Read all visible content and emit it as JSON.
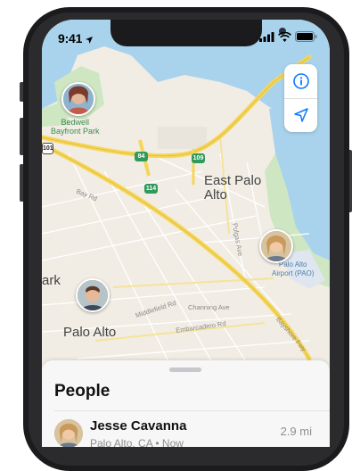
{
  "status_bar": {
    "time": "9:41"
  },
  "map": {
    "labels": {
      "bedwell": "Bedwell\nBayfront Park",
      "east_palo_alto": "East Palo\nAlto",
      "palo_alto": "Palo Alto",
      "park": "ark",
      "airport": "Palo Alto\nAirport (PAO)",
      "bay_rd": "Bay Rd",
      "pulgas": "Pulgas Ave",
      "middlefield": "Middlefield Rd",
      "channing": "Channing Ave",
      "embarcadero": "Embarcadero Rd",
      "bayshore": "Bayshore Fwy"
    },
    "shields": {
      "s101": "101",
      "s84": "84",
      "s109": "109",
      "s114": "114"
    }
  },
  "controls": {
    "info_icon": "info-icon",
    "location_icon": "location-arrow-icon"
  },
  "sheet": {
    "title": "People",
    "people": [
      {
        "name": "Jesse Cavanna",
        "subtitle": "Palo Alto, CA • Now",
        "distance": "2.9 mi"
      }
    ]
  },
  "colors": {
    "water": "#a9d3ec",
    "land": "#f1ede4",
    "park": "#cfe6c3",
    "highway": "#f5d65a",
    "accent": "#0a7aff"
  }
}
